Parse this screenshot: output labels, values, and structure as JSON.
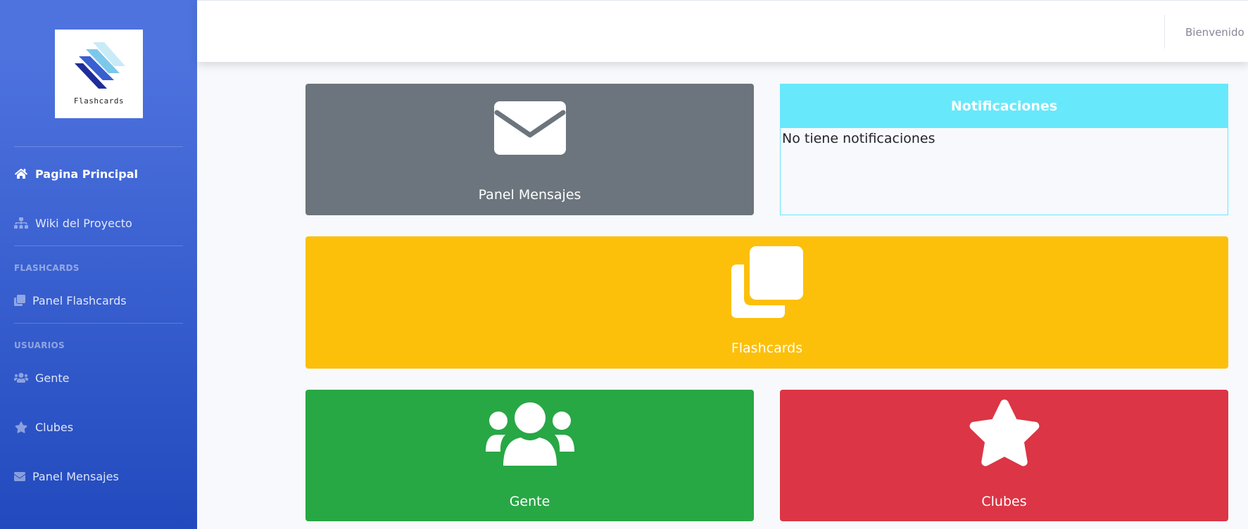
{
  "sidebar": {
    "brand_text": "Flashcards",
    "items": [
      {
        "label": "Pagina Principal",
        "icon": "home-icon"
      },
      {
        "label": "Wiki del Proyecto",
        "icon": "sitemap-icon"
      },
      {
        "label": "Panel Flashcards",
        "icon": "clone-icon"
      },
      {
        "label": "Gente",
        "icon": "users-icon"
      },
      {
        "label": "Clubes",
        "icon": "star-icon"
      },
      {
        "label": "Panel Mensajes",
        "icon": "envelope-icon"
      }
    ],
    "headings": {
      "flashcards": "FLASHCARDS",
      "usuarios": "USUARIOS"
    },
    "colors": {
      "gradient_top": "#4e73df",
      "gradient_bottom": "#224abe"
    }
  },
  "topbar": {
    "welcome_text": "Bienvenido u"
  },
  "cards": {
    "mensajes": {
      "label": "Panel Mensajes",
      "icon": "envelope-icon",
      "color": "#6c757d"
    },
    "flashcards": {
      "label": "Flashcards",
      "icon": "clone-icon",
      "color": "#fcc00b"
    },
    "gente": {
      "label": "Gente",
      "icon": "users-icon",
      "color": "#28a745"
    },
    "clubes": {
      "label": "Clubes",
      "icon": "star-icon",
      "color": "#dc3545"
    }
  },
  "notifications": {
    "title": "Notificaciones",
    "empty_text": "No tiene notificaciones",
    "color": "#68e8fb"
  }
}
